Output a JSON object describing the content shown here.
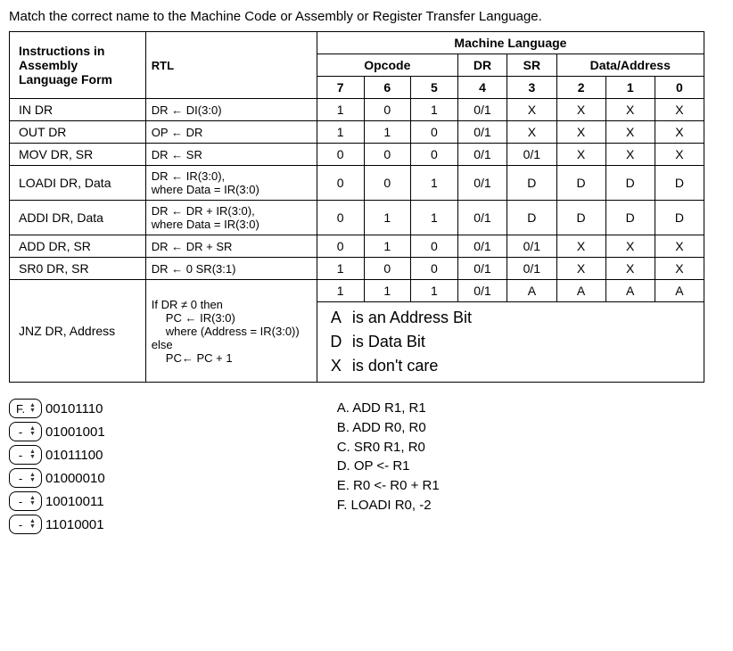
{
  "instruction": "Match the correct name to the Machine Code or Assembly or Register Transfer Language.",
  "headers": {
    "assembly": "Instructions in Assembly Language Form",
    "rtl": "RTL",
    "machine_language": "Machine Language",
    "opcode": "Opcode",
    "dr": "DR",
    "sr": "SR",
    "data_address": "Data/Address",
    "b7": "7",
    "b6": "6",
    "b5": "5",
    "b4": "4",
    "b3": "3",
    "b2": "2",
    "b1": "1",
    "b0": "0"
  },
  "rows": [
    {
      "asm": "IN  DR",
      "rtl": "DR ← DI(3:0)",
      "bits": [
        "1",
        "0",
        "1",
        "0/1",
        "X",
        "X",
        "X",
        "X"
      ]
    },
    {
      "asm": "OUT  DR",
      "rtl": "OP ← DR",
      "bits": [
        "1",
        "1",
        "0",
        "0/1",
        "X",
        "X",
        "X",
        "X"
      ]
    },
    {
      "asm": "MOV DR, SR",
      "rtl": "DR ← SR",
      "bits": [
        "0",
        "0",
        "0",
        "0/1",
        "0/1",
        "X",
        "X",
        "X"
      ]
    },
    {
      "asm": "LOADI DR, Data",
      "rtl": "DR ← IR(3:0),\nwhere Data = IR(3:0)",
      "bits": [
        "0",
        "0",
        "1",
        "0/1",
        "D",
        "D",
        "D",
        "D"
      ]
    },
    {
      "asm": "ADDI DR, Data",
      "rtl": "DR ← DR + IR(3:0),\nwhere Data = IR(3:0)",
      "bits": [
        "0",
        "1",
        "1",
        "0/1",
        "D",
        "D",
        "D",
        "D"
      ]
    },
    {
      "asm": "ADD DR, SR",
      "rtl": "DR ← DR + SR",
      "bits": [
        "0",
        "1",
        "0",
        "0/1",
        "0/1",
        "X",
        "X",
        "X"
      ]
    },
    {
      "asm": "SR0 DR, SR",
      "rtl": "DR ← 0 SR(3:1)",
      "bits": [
        "1",
        "0",
        "0",
        "0/1",
        "0/1",
        "X",
        "X",
        "X"
      ]
    }
  ],
  "jnz": {
    "asm": "JNZ DR, Address",
    "rtl_l1": "If DR ≠ 0 then",
    "rtl_l2": "PC ← IR(3:0)",
    "rtl_l3": "where (Address = IR(3:0))",
    "rtl_l4": "else",
    "rtl_l5": "PC← PC + 1",
    "bits": [
      "1",
      "1",
      "1",
      "0/1",
      "A",
      "A",
      "A",
      "A"
    ]
  },
  "legend": {
    "a_sym": "A",
    "a_txt": "is an Address Bit",
    "d_sym": "D",
    "d_txt": "is Data Bit",
    "x_sym": "X",
    "x_txt": "is don't care"
  },
  "match_items": [
    {
      "sel": "F.",
      "code": "00101110"
    },
    {
      "sel": "-",
      "code": "01001001"
    },
    {
      "sel": "-",
      "code": "01011100"
    },
    {
      "sel": "-",
      "code": "01000010"
    },
    {
      "sel": "-",
      "code": "10010011"
    },
    {
      "sel": "-",
      "code": "11010001"
    }
  ],
  "choices": [
    "A. ADD R1, R1",
    "B. ADD R0, R0",
    "C. SR0 R1, R0",
    "D. OP <- R1",
    "E. R0 <- R0 + R1",
    "F.  LOADI R0, -2"
  ]
}
